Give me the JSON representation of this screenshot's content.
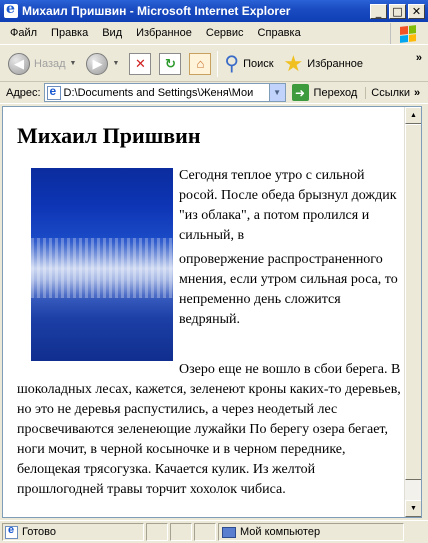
{
  "window": {
    "title": "Михаил Пришвин - Microsoft Internet Explorer",
    "minimize": "_",
    "maximize": "□",
    "close": "✕"
  },
  "menu": [
    "Файл",
    "Правка",
    "Вид",
    "Избранное",
    "Сервис",
    "Справка"
  ],
  "toolbar": {
    "back_label": "Назад",
    "search_label": "Поиск",
    "favorites_label": "Избранное",
    "more": "»"
  },
  "address": {
    "label": "Адрес:",
    "value": "D:\\Documents and Settings\\Женя\\Мои",
    "go_label": "Переход",
    "links_label": "Ссылки",
    "more": "»"
  },
  "page": {
    "heading": "Михаил Пришвин",
    "paragraph1": "Сегодня теплое утро с сильной росой. После обеда брызнул дождик \"из облака\", а потом пролился и сильный, в",
    "paragraph2": "опровержение распространенного мнения, если утром сильная роса, то непременно день сложится ведряный.",
    "paragraph3": "Озеро еще не вошло в сбои берега. В шоколадных лесах, кажется, зеленеют кроны каких-то деревьев, но это не деревья распустились, а через неодетый лес просвечиваются зеленеющие лужайки По берегу озера бегает, ноги мочит, в черной косыночке и в черном переднике, белощекая трясогузка. Качается кулик. Из желтой прошлогодней травы торчит хохолок чибиса."
  },
  "status": {
    "text": "Готово",
    "zone": "Мой компьютер"
  }
}
